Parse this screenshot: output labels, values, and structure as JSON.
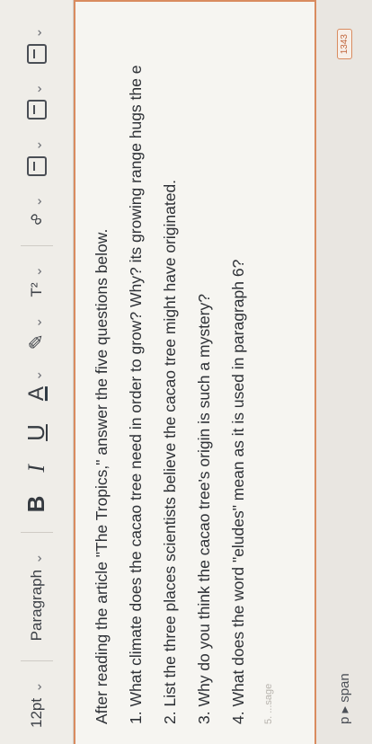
{
  "toolbar": {
    "font_size": "12pt",
    "block_format": "Paragraph",
    "bold": "B",
    "italic": "I",
    "underline": "U",
    "text_color": "A",
    "superscript": "T²"
  },
  "editor": {
    "lines": [
      "After reading the article \"The Tropics,\" answer the five questions below.",
      "1. What climate does the cacao tree need in order to grow? Why? its growing range hugs the e",
      "2. List the three places scientists believe the cacao tree might have originated.",
      "3. Why do you think the cacao tree's origin is such a mystery?",
      "4. What does the word \"eludes\" mean as it is used in paragraph 6?"
    ],
    "faded": "5. ...sage"
  },
  "status": {
    "path": "p ▸ span",
    "word_count": "1343"
  },
  "colors": {
    "accent_border": "#d98b5f",
    "background": "#f6f5f1"
  }
}
